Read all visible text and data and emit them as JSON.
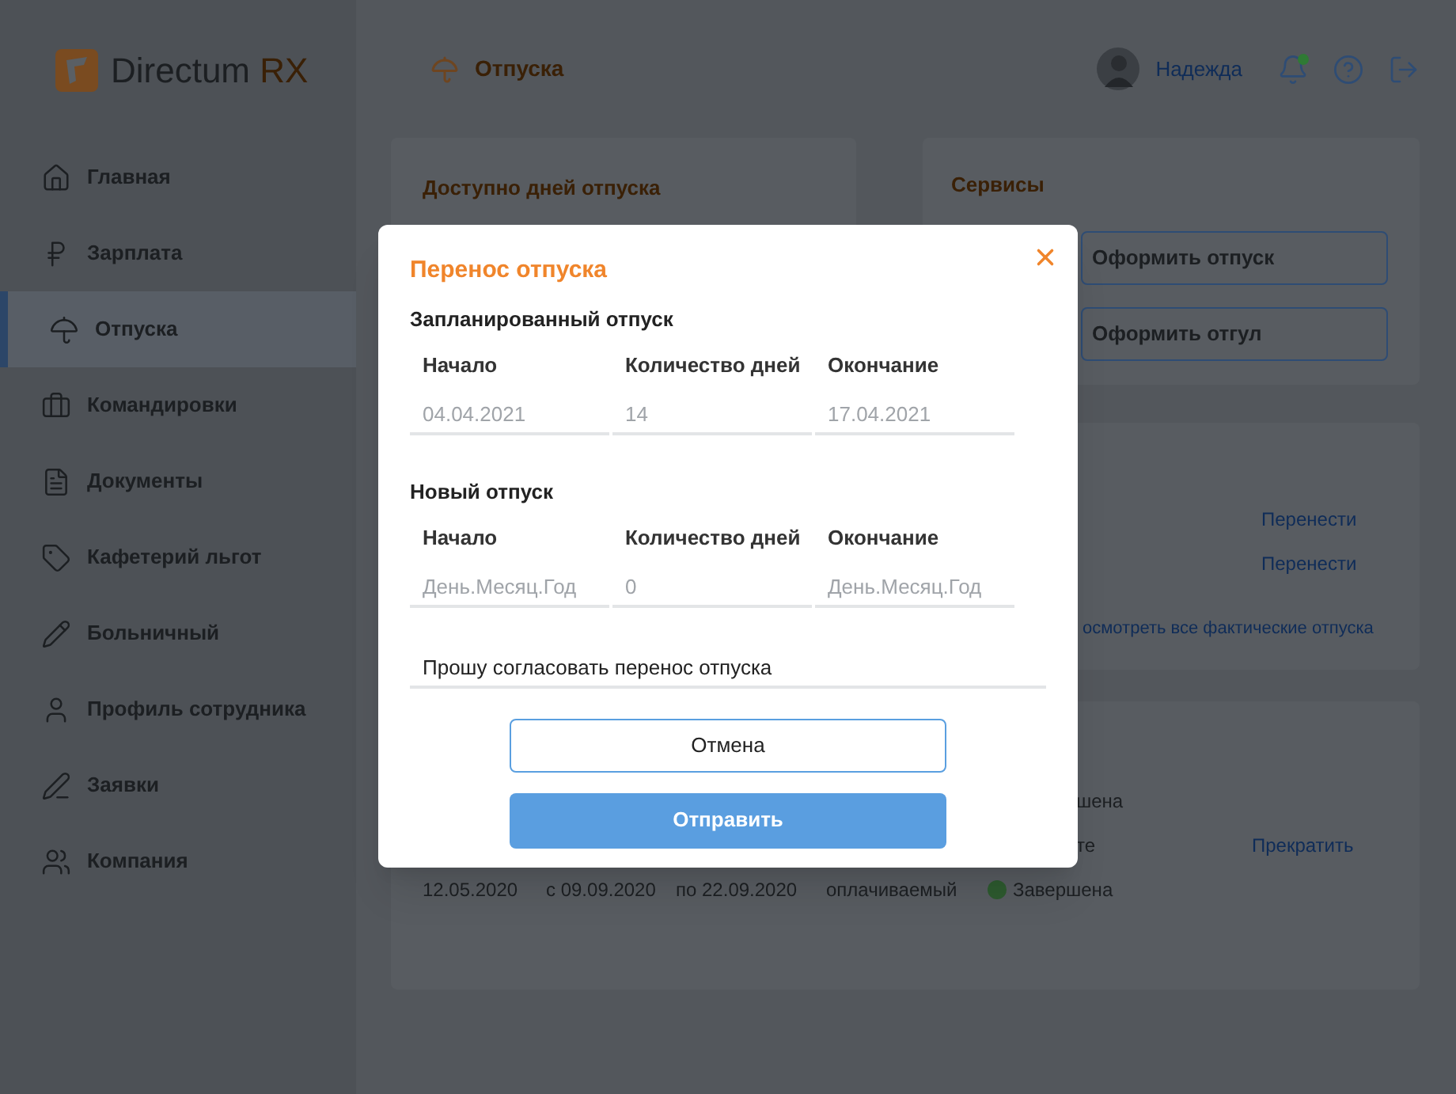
{
  "app": {
    "logo_text": "Directum",
    "logo_suffix": "RX"
  },
  "header": {
    "title": "Отпуска",
    "user": "Надежда",
    "notifications_unread": true
  },
  "sidebar": {
    "items": [
      {
        "label": "Главная",
        "selected": false
      },
      {
        "label": "Зарплата",
        "selected": false
      },
      {
        "label": "Отпуска",
        "selected": true
      },
      {
        "label": "Командировки",
        "selected": false
      },
      {
        "label": "Документы",
        "selected": false
      },
      {
        "label": "Кафетерий льгот",
        "selected": false
      },
      {
        "label": "Больничный",
        "selected": false
      },
      {
        "label": "Профиль сотрудника",
        "selected": false
      },
      {
        "label": "Заявки",
        "selected": false
      },
      {
        "label": "Компания",
        "selected": false
      }
    ]
  },
  "available_days": {
    "title": "Доступно дней отпуска"
  },
  "services": {
    "title": "Сервисы",
    "buttons": [
      "Оформить отпуск",
      "Оформить отгул"
    ]
  },
  "planned": {
    "actions": [
      "Перенести",
      "Перенести"
    ],
    "link": "осмотреть все фактические отпуска"
  },
  "history": {
    "rows": [
      {
        "kind": "partial",
        "status": "шена"
      },
      {
        "kind": "partial",
        "status": "те",
        "action": "Прекратить"
      },
      {
        "kind": "full",
        "date": "12.05.2020",
        "from": "с 09.09.2020",
        "to": "по 22.09.2020",
        "type": "оплачиваемый",
        "status": "Завершена",
        "color": "#2d5a2f"
      }
    ]
  },
  "dialog": {
    "title": "Перенос отпуска",
    "sections": [
      {
        "title": "Запланированный отпуск",
        "fields": [
          {
            "label": "Начало",
            "value": "04.04.2021"
          },
          {
            "label": "Количество дней",
            "value": "14"
          },
          {
            "label": "Окончание",
            "value": "17.04.2021"
          }
        ]
      },
      {
        "title": "Новый отпуск",
        "fields": [
          {
            "label": "Начало",
            "placeholder": "День.Месяц.Год"
          },
          {
            "label": "Количество дней",
            "placeholder": "0"
          },
          {
            "label": "Окончание",
            "placeholder": "День.Месяц.Год"
          }
        ]
      }
    ],
    "comment": "Прошу согласовать перенос отпуска",
    "cancel": "Отмена",
    "submit": "Отправить"
  }
}
